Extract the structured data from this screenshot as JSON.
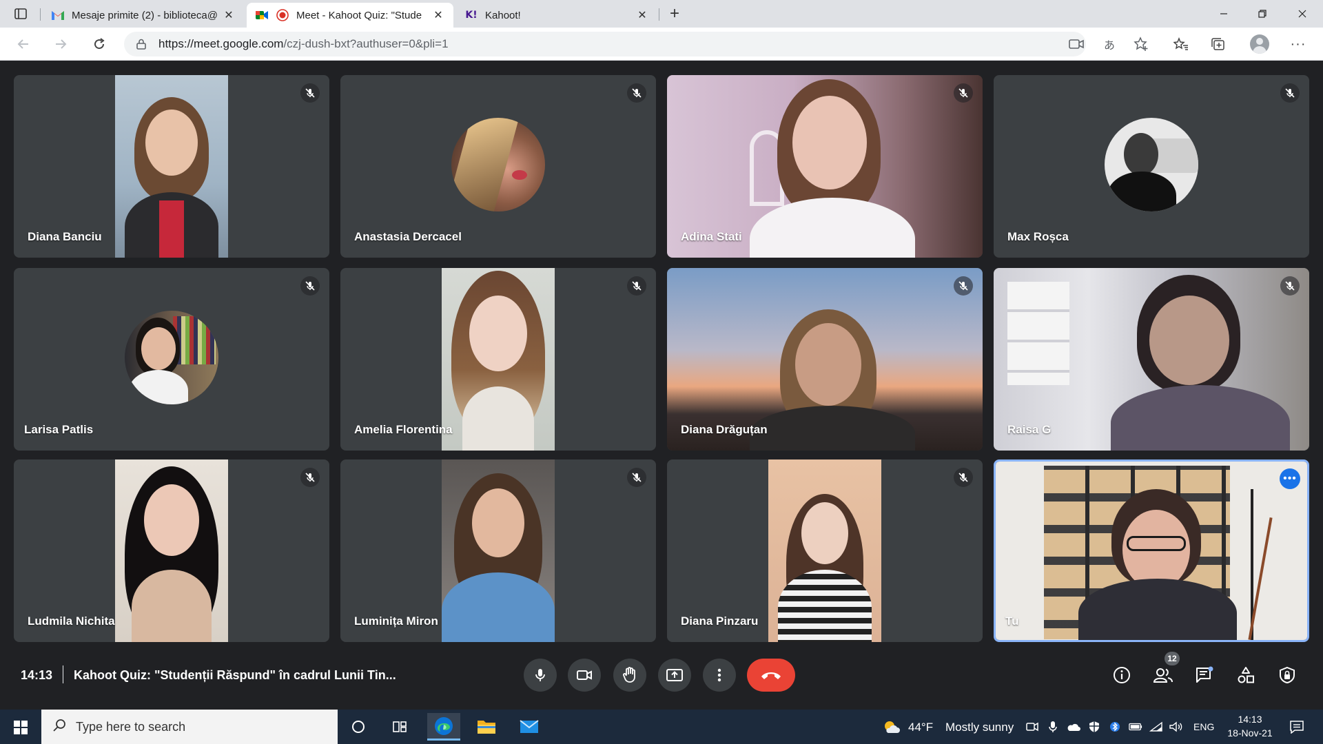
{
  "browser": {
    "tabs": [
      {
        "label": "Mesaje primite (2) - biblioteca@",
        "icon": "gmail-icon"
      },
      {
        "label": "Meet - Kahoot Quiz: \"Stude",
        "icon": "meet-icon",
        "active": true
      },
      {
        "label": "Kahoot!",
        "icon": "kahoot-icon"
      }
    ],
    "kahoot_favicon": "K!",
    "url_host": "https://meet.google.com",
    "url_path": "/czj-dush-bxt?authuser=0&pli=1"
  },
  "participants": [
    {
      "name": "Diana Banciu",
      "muted": true
    },
    {
      "name": "Anastasia Dercacel",
      "muted": true
    },
    {
      "name": "Adina Stati",
      "muted": true
    },
    {
      "name": "Max Roșca",
      "muted": true
    },
    {
      "name": "Larisa Patlis",
      "muted": true
    },
    {
      "name": "Amelia Florentina",
      "muted": true
    },
    {
      "name": "Diana Drăguțan",
      "muted": true
    },
    {
      "name": "Raisa G",
      "muted": true
    },
    {
      "name": "Ludmila Nichita",
      "muted": true
    },
    {
      "name": "Luminița Miron",
      "muted": true
    },
    {
      "name": "Diana Pinzaru",
      "muted": true
    },
    {
      "name": "Tu",
      "self": true
    }
  ],
  "meeting": {
    "time": "14:13",
    "title": "Kahoot Quiz: \"Studenții Răspund\" în cadrul Lunii Tin...",
    "participant_count": "12"
  },
  "colors": {
    "accent": "#1a73e8",
    "end_call": "#ea4335",
    "tile_bg": "#3c4043",
    "meet_bg": "#202124"
  },
  "taskbar": {
    "search_placeholder": "Type here to search",
    "weather_temp": "44°F",
    "weather_text": "Mostly sunny",
    "language": "ENG",
    "time": "14:13",
    "date": "18-Nov-21"
  }
}
